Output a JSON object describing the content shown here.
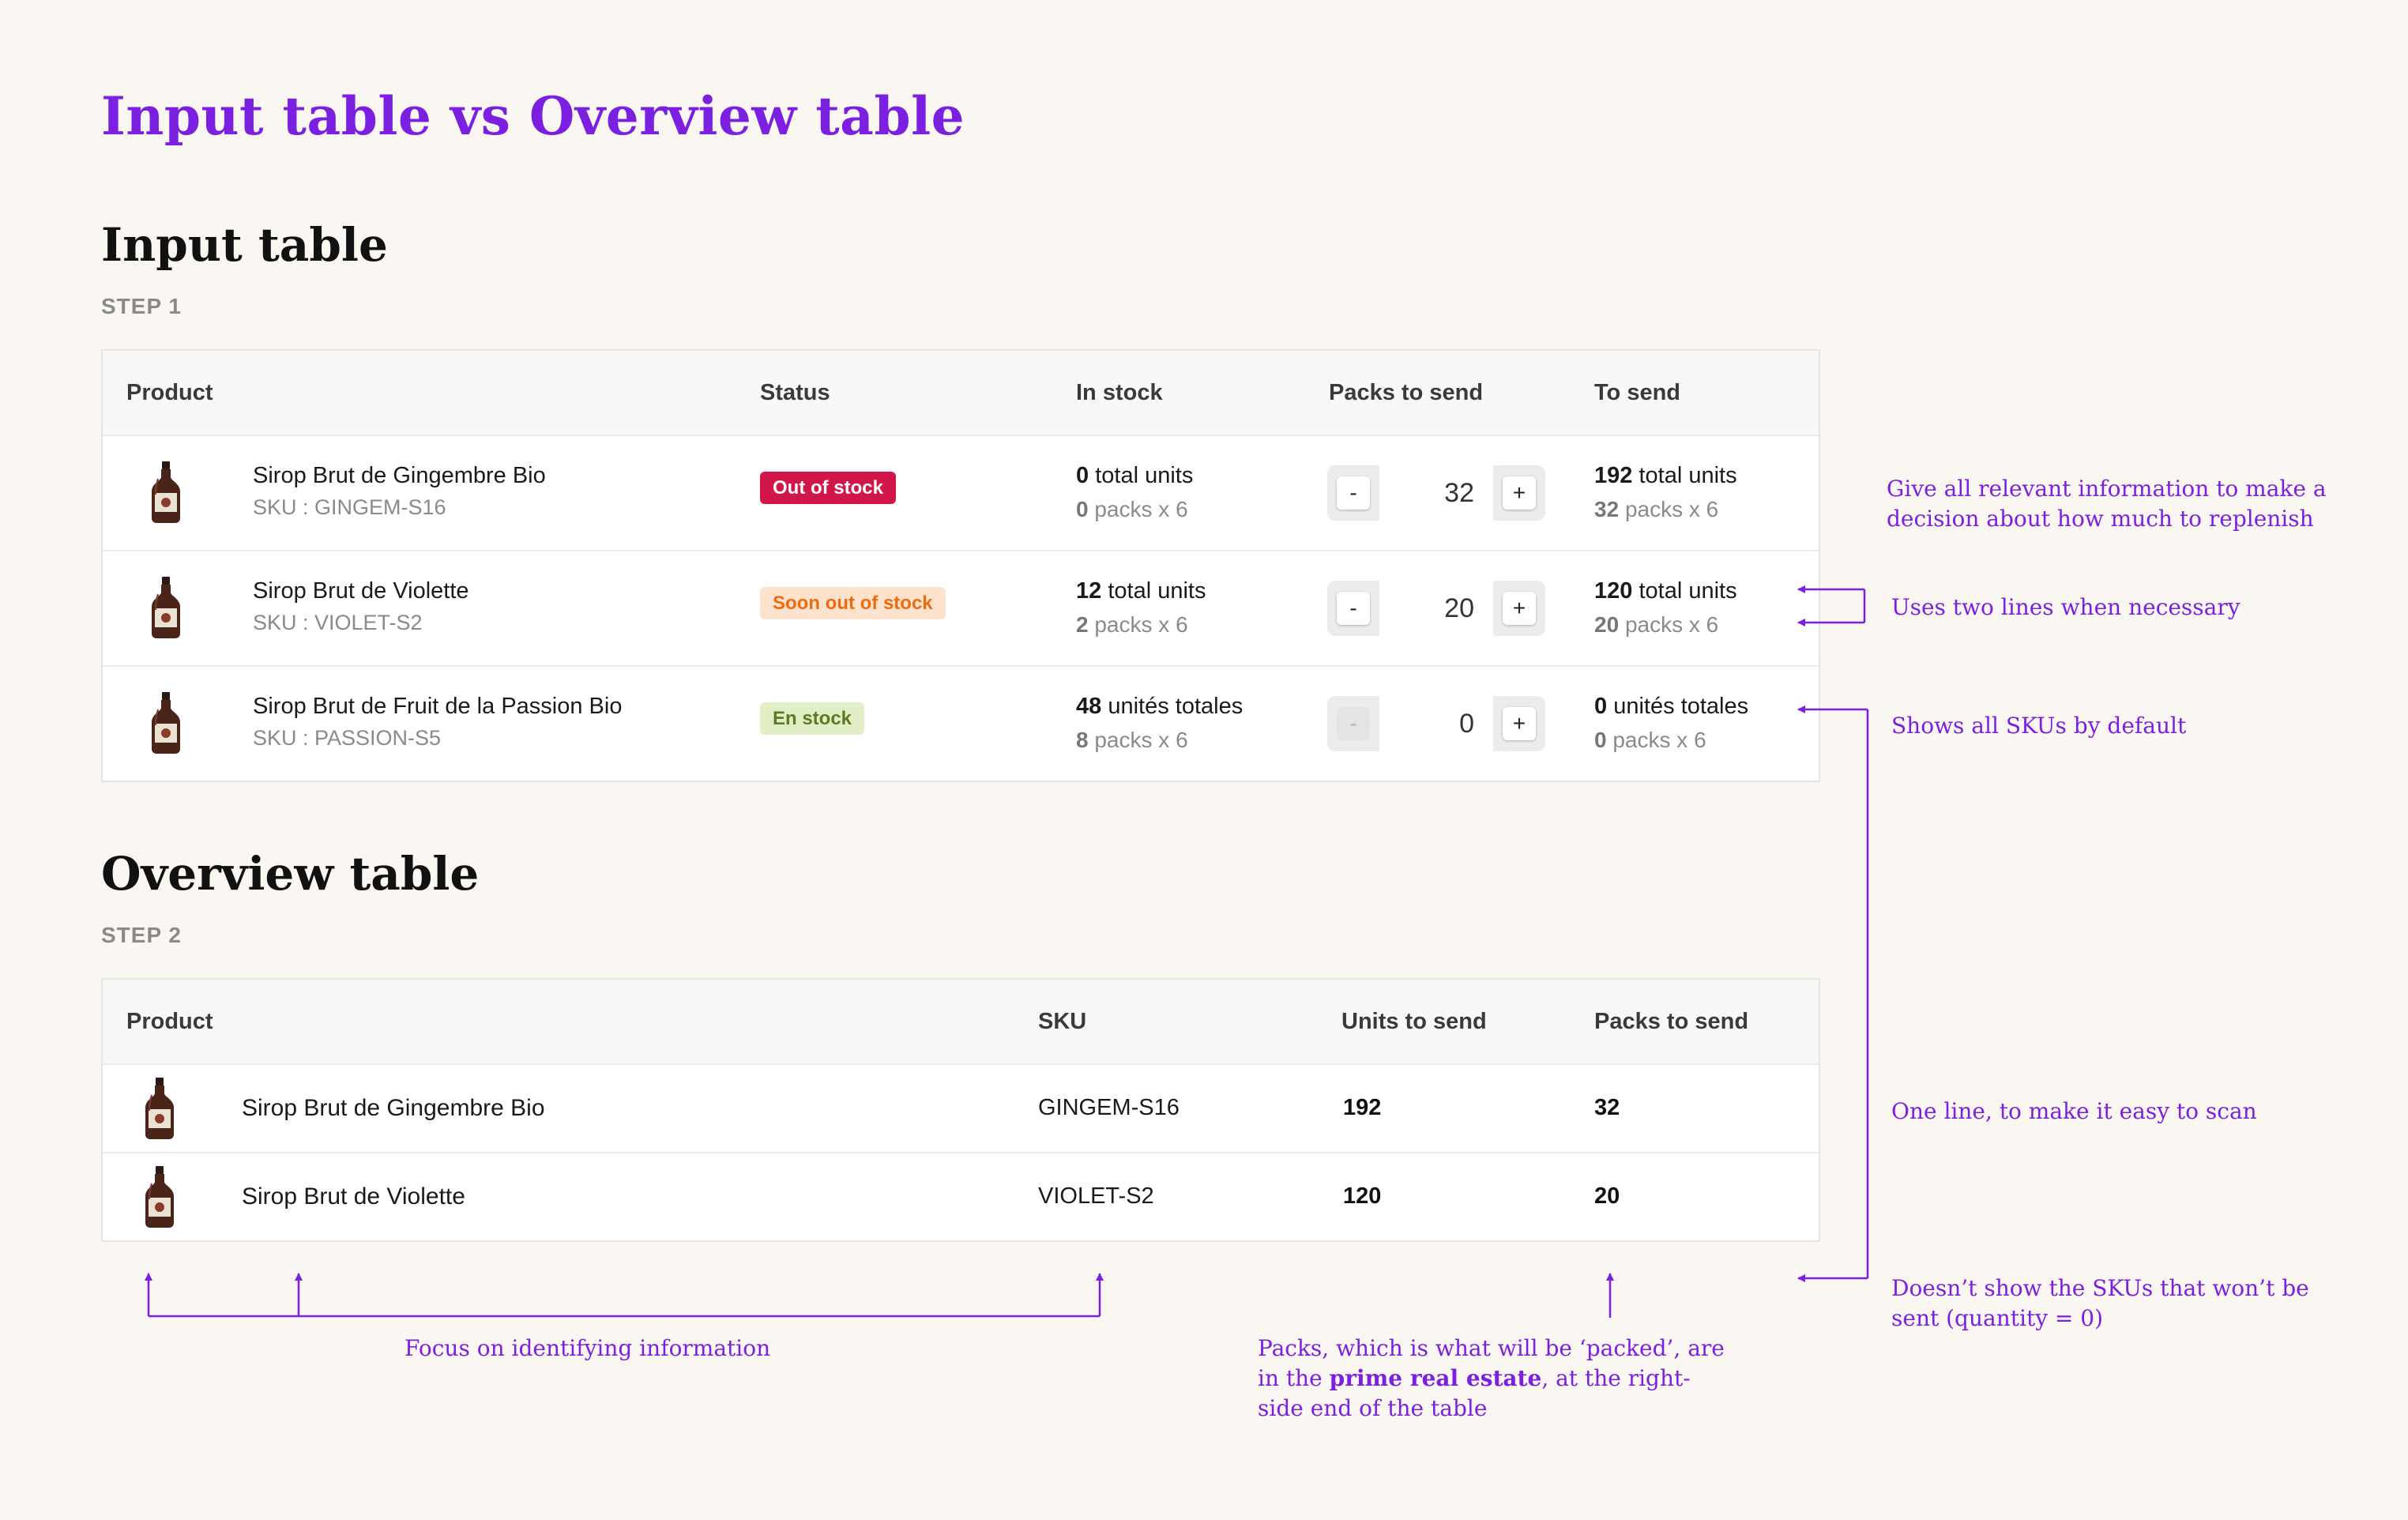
{
  "page_title": "Input table vs Overview table",
  "input_section": {
    "title": "Input table",
    "step": "STEP 1",
    "headers": {
      "product": "Product",
      "status": "Status",
      "in_stock": "In stock",
      "packs_to_send": "Packs to send",
      "to_send": "To send"
    },
    "rows": [
      {
        "name": "Sirop Brut de Gingembre Bio",
        "sku": "SKU : GINGEM-S16",
        "status": "Out of stock",
        "stock_units": "0",
        "stock_units_label": "total units",
        "stock_packs": "0",
        "stock_packs_label": "packs x 6",
        "packs_value": "32",
        "send_units": "192",
        "send_units_label": "total units",
        "send_packs": "32",
        "send_packs_label": "packs x 6"
      },
      {
        "name": "Sirop Brut de Violette",
        "sku": "SKU : VIOLET-S2",
        "status": "Soon out of stock",
        "stock_units": "12",
        "stock_units_label": "total units",
        "stock_packs": "2",
        "stock_packs_label": "packs x 6",
        "packs_value": "20",
        "send_units": "120",
        "send_units_label": "total units",
        "send_packs": "20",
        "send_packs_label": "packs x 6"
      },
      {
        "name": "Sirop Brut de Fruit de la Passion Bio",
        "sku": "SKU : PASSION-S5",
        "status": "En stock",
        "stock_units": "48",
        "stock_units_label": "unités totales",
        "stock_packs": "8",
        "stock_packs_label": "packs x 6",
        "packs_value": "0",
        "send_units": "0",
        "send_units_label": "unités totales",
        "send_packs": "0",
        "send_packs_label": "packs x 6"
      }
    ],
    "stepper": {
      "minus": "-",
      "plus": "+"
    }
  },
  "overview_section": {
    "title": "Overview table",
    "step": "STEP 2",
    "headers": {
      "product": "Product",
      "sku": "SKU",
      "units_to_send": "Units to send",
      "packs_to_send": "Packs to send"
    },
    "rows": [
      {
        "name": "Sirop Brut de Gingembre Bio",
        "sku": "GINGEM-S16",
        "units": "192",
        "packs": "32"
      },
      {
        "name": "Sirop Brut de Violette",
        "sku": "VIOLET-S2",
        "units": "120",
        "packs": "20"
      }
    ]
  },
  "annotations": {
    "relevant_info": "Give all relevant information to make a decision about how much to replenish",
    "two_lines": "Uses two lines when necessary",
    "all_skus": "Shows all SKUs by default",
    "one_line": "One line, to make it easy to scan",
    "no_zero_skus": "Doesn’t show the SKUs that won’t be sent (quantity = 0)",
    "identifying": "Focus on identifying information",
    "packs_prefix": "Packs, which is what will be ‘packed’, are in the ",
    "packs_bold": "prime real estate",
    "packs_suffix": ", at the right-side end of the table"
  },
  "colors": {
    "accent": "#7b1fe0",
    "out_of_stock": "#d3164a",
    "soon_out": "#ee6a10",
    "in_stock": "#5c7a26"
  },
  "icons": {
    "product": "syrup-bottle-icon"
  }
}
